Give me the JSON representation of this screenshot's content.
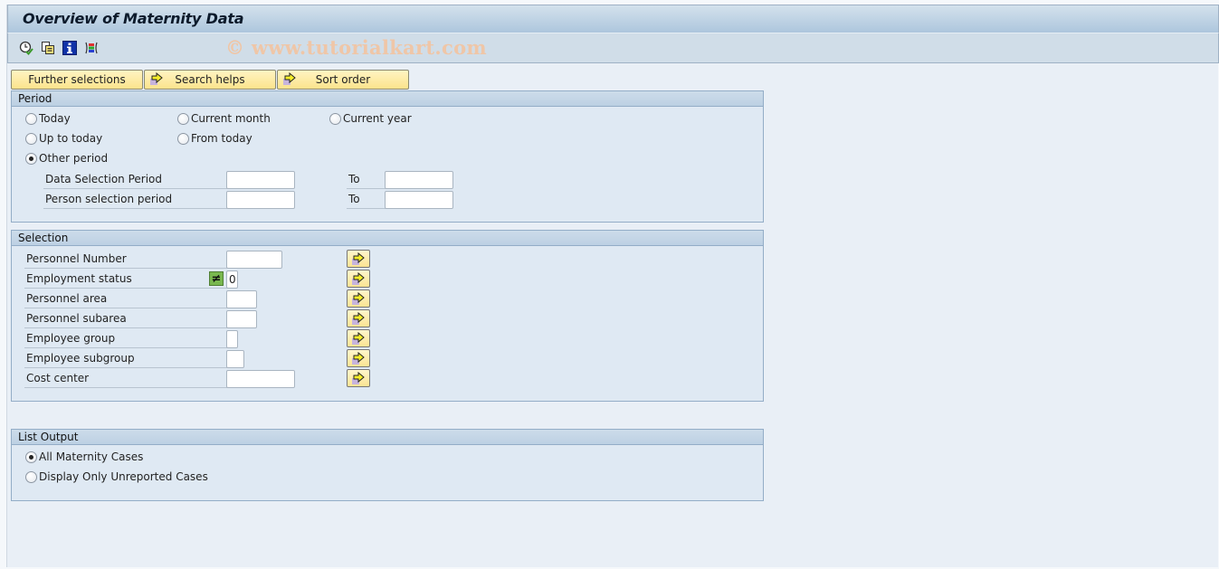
{
  "window": {
    "title": "Overview of Maternity Data",
    "watermark": "© www.tutorialkart.com"
  },
  "toolbar": {
    "icons": [
      {
        "name": "execute-icon",
        "tooltip": "Execute"
      },
      {
        "name": "get-variant-icon",
        "tooltip": "Get Variant"
      },
      {
        "name": "program-documentation-icon",
        "tooltip": "Program Documentation"
      },
      {
        "name": "dynamic-selections-icon",
        "tooltip": "Dynamic Selections"
      }
    ]
  },
  "tabs": [
    {
      "label": "Further selections",
      "has_arrow": false
    },
    {
      "label": "Search helps",
      "has_arrow": true
    },
    {
      "label": "Sort order",
      "has_arrow": true
    }
  ],
  "period": {
    "title": "Period",
    "options": [
      {
        "label": "Today",
        "selected": false
      },
      {
        "label": "Current month",
        "selected": false
      },
      {
        "label": "Current year",
        "selected": false
      },
      {
        "label": "Up to today",
        "selected": false
      },
      {
        "label": "From today",
        "selected": false
      },
      {
        "label": "Other period",
        "selected": true
      }
    ],
    "ranges": [
      {
        "label": "Data Selection Period",
        "from": "",
        "to_label": "To",
        "to": ""
      },
      {
        "label": "Person selection period",
        "from": "",
        "to_label": "To",
        "to": ""
      }
    ]
  },
  "selection": {
    "title": "Selection",
    "fields": [
      {
        "label": "Personnel Number",
        "value": "",
        "option": null
      },
      {
        "label": "Employment status",
        "value": "0",
        "option": "≠"
      },
      {
        "label": "Personnel area",
        "value": "",
        "option": null
      },
      {
        "label": "Personnel subarea",
        "value": "",
        "option": null
      },
      {
        "label": "Employee group",
        "value": "",
        "option": null
      },
      {
        "label": "Employee subgroup",
        "value": "",
        "option": null
      },
      {
        "label": "Cost center",
        "value": "",
        "option": null
      }
    ]
  },
  "list_output": {
    "title": "List Output",
    "options": [
      {
        "label": "All Maternity Cases",
        "selected": true
      },
      {
        "label": "Display Only Unreported Cases",
        "selected": false
      }
    ]
  }
}
